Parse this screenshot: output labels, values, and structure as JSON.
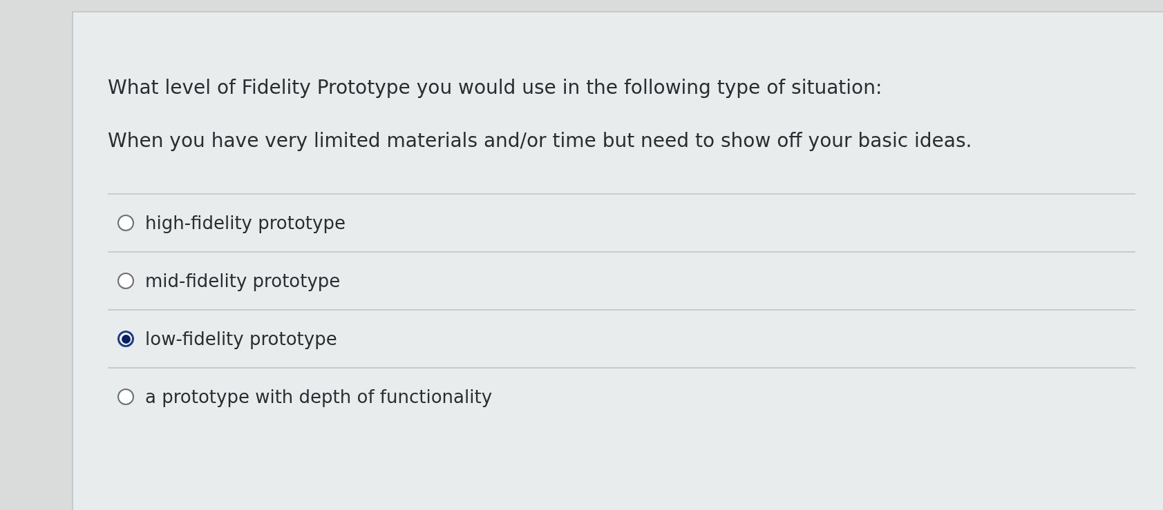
{
  "question": {
    "prompt": "What level of Fidelity Prototype you would use in the following type of situation:",
    "situation": "When you have very limited materials and/or time but need to show off your basic ideas."
  },
  "answers": [
    {
      "label": "high-fidelity prototype",
      "selected": false
    },
    {
      "label": "mid-fidelity prototype",
      "selected": false
    },
    {
      "label": "low-fidelity prototype",
      "selected": true
    },
    {
      "label": "a prototype with depth of functionality",
      "selected": false
    }
  ]
}
